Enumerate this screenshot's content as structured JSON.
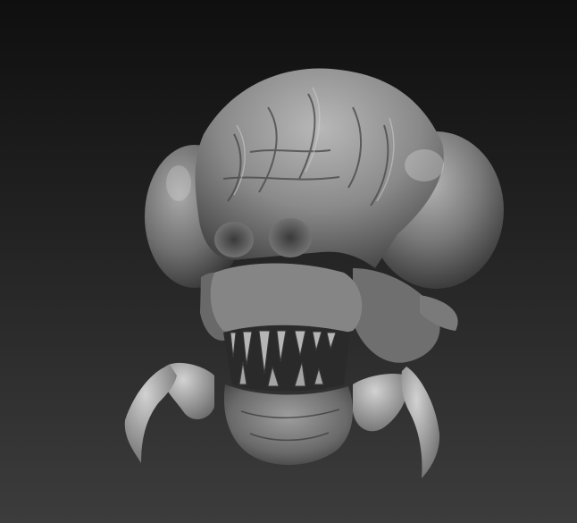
{
  "canvas": {
    "background_top": "#0f0f0f",
    "background_bottom": "#3c3c3c",
    "clay_color": "#8e8e8e",
    "clay_highlight": "#c8c8c8",
    "clay_shadow": "#2e2e2e"
  },
  "subject": {
    "icon": "alien-creature-sculpt-icon"
  }
}
